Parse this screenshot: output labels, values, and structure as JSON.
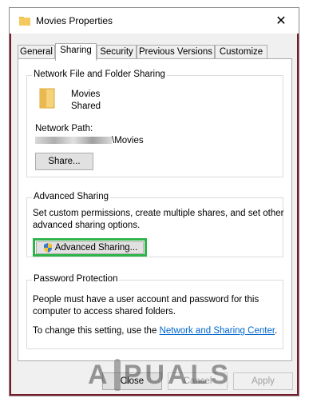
{
  "window": {
    "title": "Movies Properties"
  },
  "tabs": [
    {
      "label": "General"
    },
    {
      "label": "Sharing"
    },
    {
      "label": "Security"
    },
    {
      "label": "Previous Versions"
    },
    {
      "label": "Customize"
    }
  ],
  "network_sharing": {
    "group_title": "Network File and Folder Sharing",
    "folder_name": "Movies",
    "folder_status": "Shared",
    "path_label": "Network Path:",
    "path_suffix": "\\Movies",
    "share_button": "Share..."
  },
  "advanced_sharing": {
    "group_title": "Advanced Sharing",
    "description_line1": "Set custom permissions, create multiple shares, and set other",
    "description_line2": "advanced sharing options.",
    "button_label": "Advanced Sharing..."
  },
  "password_protection": {
    "group_title": "Password Protection",
    "description_line1": "People must have a user account and password for this",
    "description_line2": "computer to access shared folders.",
    "change_text": "To change this setting, use the",
    "link_text": "Network and Sharing Center",
    "period": "."
  },
  "footer": {
    "close_label": "Close",
    "cancel_label": "Cancel",
    "apply_label": "Apply"
  },
  "watermark": {
    "text_left": "A",
    "text_right": "PUALS"
  },
  "colors": {
    "highlight": "#2fb44a",
    "link": "#0066cc",
    "title_accent": "#7a1a2a"
  }
}
